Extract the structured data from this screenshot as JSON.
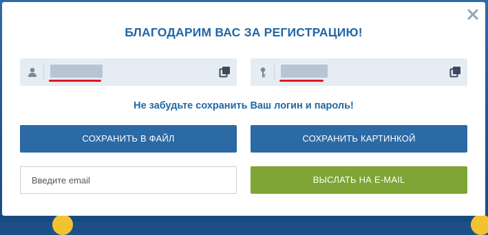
{
  "dialog": {
    "title": "БЛАГОДАРИМ ВАС ЗА РЕГИСТРАЦИЮ!",
    "close_icon": "close-icon",
    "hint": "Не забудьте сохранить Ваш логин и пароль!"
  },
  "credentials": {
    "login": {
      "icon": "user-icon",
      "value": "",
      "copy_icon": "copy-icon"
    },
    "password": {
      "icon": "key-icon",
      "value": "",
      "copy_icon": "copy-icon"
    }
  },
  "buttons": {
    "save_file": "СОХРАНИТЬ В ФАЙЛ",
    "save_picture": "СОХРАНИТЬ КАРТИНКОЙ",
    "send_email": "ВЫСЛАТЬ НА E-MAIL"
  },
  "email": {
    "placeholder": "Введите email",
    "value": ""
  },
  "colors": {
    "title": "#2067a6",
    "button_blue": "#2b6aa4",
    "button_green": "#7ea535",
    "field_bg": "#e6ecf3",
    "highlight_underline": "#e2141b"
  }
}
